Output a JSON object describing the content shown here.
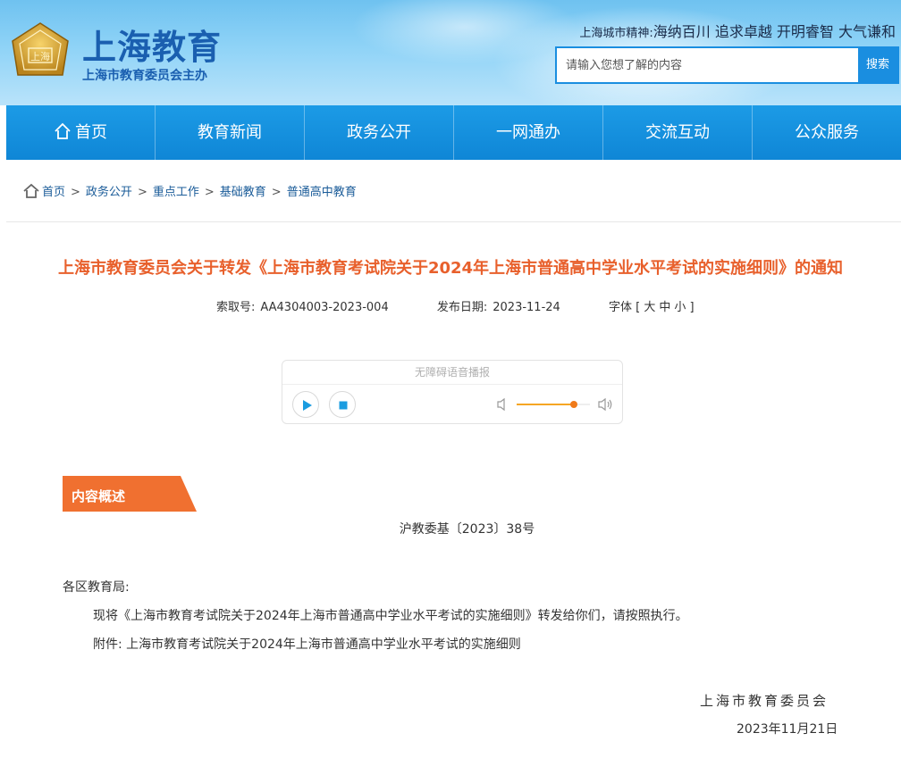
{
  "header": {
    "title": "上海教育",
    "subtitle": "上海市教育委员会主办",
    "emblem_text": "上海",
    "spirit_label": "上海城市精神:",
    "spirit_text": "海纳百川 追求卓越 开明睿智 大气谦和",
    "search": {
      "placeholder": "请输入您想了解的内容",
      "button": "搜索"
    }
  },
  "nav": {
    "items": [
      {
        "label": "首页",
        "icon": "home-icon"
      },
      {
        "label": "教育新闻"
      },
      {
        "label": "政务公开"
      },
      {
        "label": "一网通办"
      },
      {
        "label": "交流互动"
      },
      {
        "label": "公众服务"
      }
    ]
  },
  "breadcrumb": {
    "items": [
      "首页",
      "政务公开",
      "重点工作",
      "基础教育",
      "普通高中教育"
    ],
    "separator": ">"
  },
  "article": {
    "title": "上海市教育委员会关于转发《上海市教育考试院关于2024年上海市普通高中学业水平考试的实施细则》的通知",
    "index_label": "索取号:",
    "index_value": "AA4304003-2023-004",
    "date_label": "发布日期:",
    "date_value": "2023-11-24",
    "font_label": "字体",
    "font_sizes": [
      "大",
      "中",
      "小"
    ]
  },
  "player": {
    "title": "无障碍语音播报",
    "volume_fraction": 0.78
  },
  "content": {
    "summary_tag": "内容概述",
    "doc_number": "沪教委基〔2023〕38号",
    "greeting": "各区教育局:",
    "para1": "现将《上海市教育考试院关于2024年上海市普通高中学业水平考试的实施细则》转发给你们，请按照执行。",
    "para2": "附件: 上海市教育考试院关于2024年上海市普通高中学业水平考试的实施细则",
    "signature": "上海市教育委员会",
    "sign_date": "2023年11月21日"
  },
  "colors": {
    "brand_blue": "#1a5fb0",
    "nav_blue": "#1c9be6",
    "title_orange": "#e8602c",
    "tag_orange": "#f07030"
  }
}
